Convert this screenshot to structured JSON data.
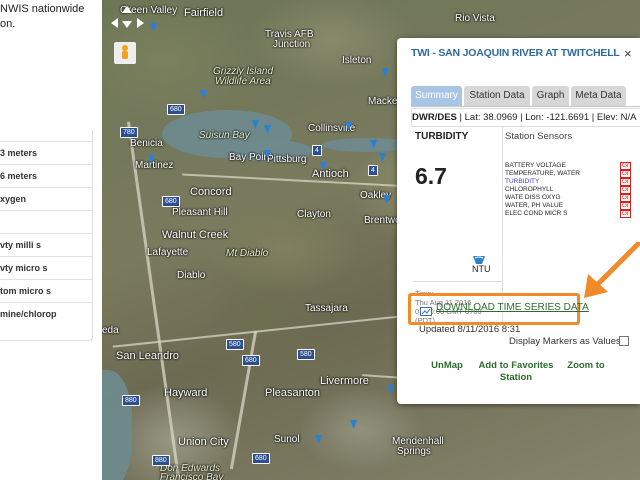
{
  "sidebar": {
    "intro_lines": [
      "NWIS nationwide",
      "on."
    ],
    "rows": [
      "3 meters",
      "6 meters",
      "xygen",
      "",
      "vty milli s",
      "vty micro s",
      "tom micro s",
      "mine/chlorop"
    ]
  },
  "map": {
    "cities": [
      {
        "name": "Fairfield",
        "cls": "big"
      },
      {
        "name": "Green Valley",
        "cls": ""
      },
      {
        "name": "Travis AFB",
        "cls": ""
      },
      {
        "name": "Rio Vista",
        "cls": ""
      },
      {
        "name": "Junction",
        "cls": ""
      },
      {
        "name": "Grizzly Island",
        "cls": "italic"
      },
      {
        "name": "Wildlife Area",
        "cls": "italic"
      },
      {
        "name": "Suisun Bay",
        "cls": "italic"
      },
      {
        "name": "Collinsville",
        "cls": ""
      },
      {
        "name": "Benicia",
        "cls": ""
      },
      {
        "name": "Martinez",
        "cls": ""
      },
      {
        "name": "Bay Point",
        "cls": ""
      },
      {
        "name": "Pittsburg",
        "cls": ""
      },
      {
        "name": "Antioch",
        "cls": "big"
      },
      {
        "name": "Concord",
        "cls": "big"
      },
      {
        "name": "Pleasant Hill",
        "cls": ""
      },
      {
        "name": "Walnut Creek",
        "cls": "big"
      },
      {
        "name": "Lafayette",
        "cls": ""
      },
      {
        "name": "Mt Diablo",
        "cls": "italic"
      },
      {
        "name": "Clayton",
        "cls": ""
      },
      {
        "name": "Diablo",
        "cls": ""
      },
      {
        "name": "Tassajara",
        "cls": ""
      },
      {
        "name": "Brentwo",
        "cls": ""
      },
      {
        "name": "San Leandro",
        "cls": "big"
      },
      {
        "name": "Hayward",
        "cls": "big"
      },
      {
        "name": "Pleasanton",
        "cls": "big"
      },
      {
        "name": "Livermore",
        "cls": "big"
      },
      {
        "name": "Union City",
        "cls": "big"
      },
      {
        "name": "Sunol",
        "cls": ""
      },
      {
        "name": "Mendenhall",
        "cls": ""
      },
      {
        "name": "Springs",
        "cls": ""
      },
      {
        "name": "Don Edwards",
        "cls": "italic"
      },
      {
        "name": "Francisco Bay",
        "cls": "italic"
      },
      {
        "name": "Macke",
        "cls": ""
      },
      {
        "name": "Isleton",
        "cls": ""
      },
      {
        "name": "Oakley",
        "cls": ""
      },
      {
        "name": "eda",
        "cls": ""
      }
    ],
    "shields": [
      "680",
      "780",
      "680",
      "680",
      "580",
      "580",
      "680",
      "880",
      "880",
      "4",
      "4",
      "12"
    ]
  },
  "popup": {
    "title": "TWI - SAN JOAQUIN RIVER AT TWITCHELL",
    "close": "×",
    "tabs": [
      "Summary",
      "Station Data",
      "Graph",
      "Meta Data"
    ],
    "active_tab": "Summary",
    "meta": {
      "agency": "DWR/DES",
      "lat": " | Lat: 38.0969 | Lon: -121.6691 | Elev: N/A"
    },
    "parameter": "TURBIDITY",
    "value": "6.7",
    "unit": "NTU",
    "time_label": "Time:",
    "time_lines": [
      "Thu Aug 11 2016",
      "07:30:00 GMT-0700",
      "(PDT)"
    ],
    "sensors_title": "Station Sensors",
    "sensors": [
      {
        "name": "BATTERY VOLTAGE",
        "selected": false
      },
      {
        "name": "TEMPERATURE, WATER",
        "selected": false
      },
      {
        "name": "TURBIDITY",
        "selected": true
      },
      {
        "name": "CHLOROPHYLL",
        "selected": false
      },
      {
        "name": "WATE DISS OXYG",
        "selected": false
      },
      {
        "name": "WATER, PH VALUE",
        "selected": false
      },
      {
        "name": "ELEC COND MICR S",
        "selected": false
      }
    ],
    "graph_label": "Gr",
    "download_label": "DOWNLOAD TIME SERIES DATA",
    "updated": "Updated 8/11/2016 8:31",
    "markers_label": "Display Markers as Values:",
    "actions": [
      "UnMap",
      "Add to Favorites Station",
      "Zoom to"
    ]
  },
  "colors": {
    "title": "#2e6a9e",
    "tab_active": "#a8c5e6",
    "link": "#2c6d2c",
    "highlight": "#f28a2a",
    "graph_link": "#d62020"
  },
  "icons": {
    "station_marker": "blue-pin-icon",
    "unit_icon": "water-drop-icon",
    "download_icon": "chart-icon",
    "pegman": "street-view-icon"
  }
}
